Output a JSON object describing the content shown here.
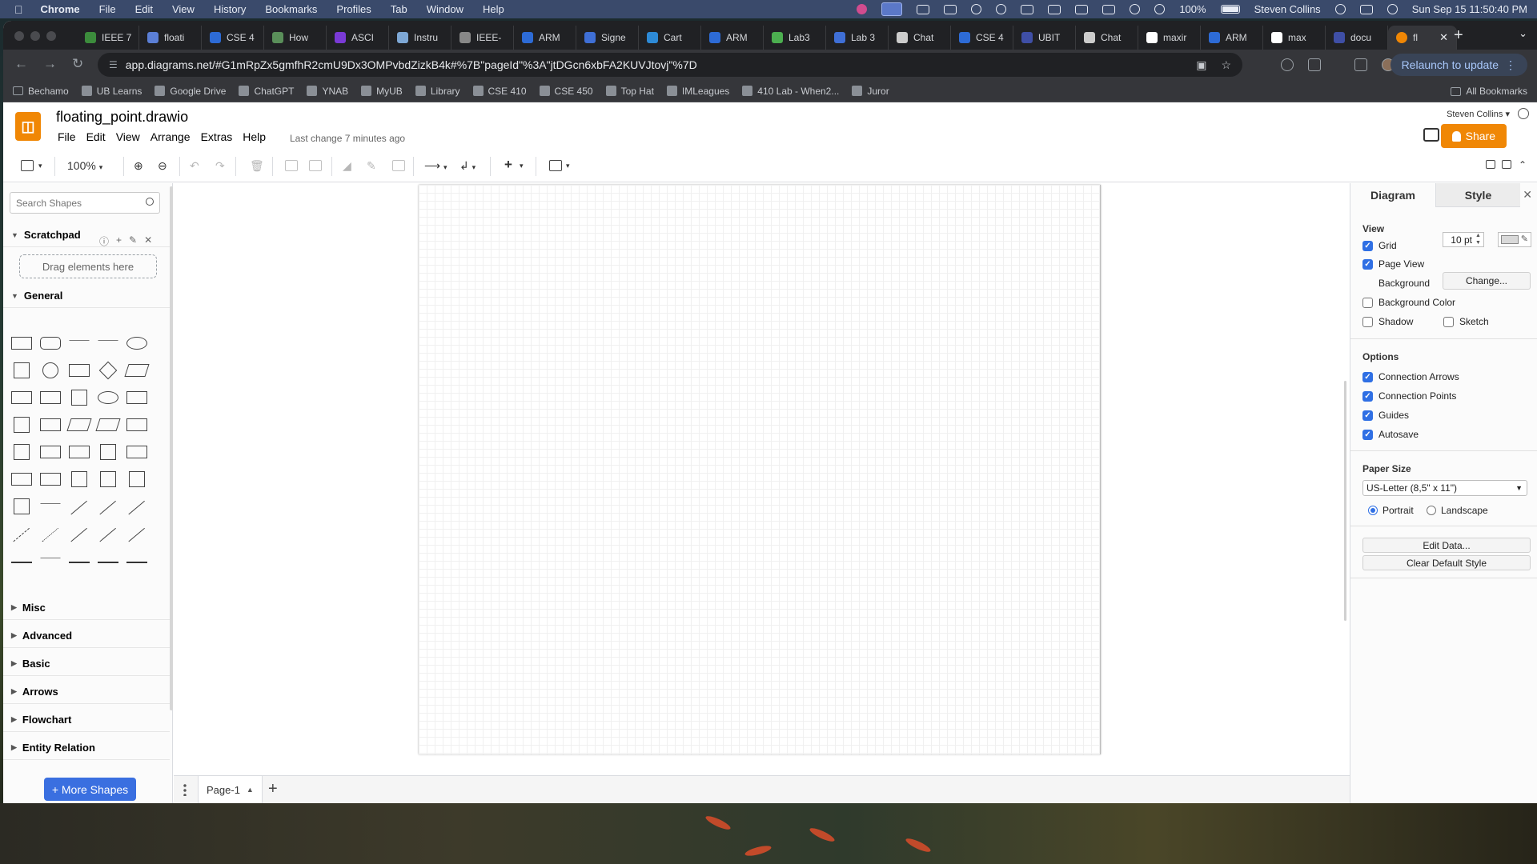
{
  "mac_menubar": {
    "app": "Chrome",
    "menus": [
      "File",
      "Edit",
      "View",
      "History",
      "Bookmarks",
      "Profiles",
      "Tab",
      "Window",
      "Help"
    ],
    "battery": "100%",
    "user": "Steven Collins",
    "datetime": "Sun Sep 15  11:50:40 PM"
  },
  "browser": {
    "tabs": [
      {
        "label": "IEEE 7"
      },
      {
        "label": "floati"
      },
      {
        "label": "CSE 4"
      },
      {
        "label": "How"
      },
      {
        "label": "ASCI"
      },
      {
        "label": "Instru"
      },
      {
        "label": "IEEE-"
      },
      {
        "label": "ARM"
      },
      {
        "label": "Signe"
      },
      {
        "label": "Cart"
      },
      {
        "label": "ARM"
      },
      {
        "label": "Lab3"
      },
      {
        "label": "Lab 3"
      },
      {
        "label": "Chat"
      },
      {
        "label": "CSE 4"
      },
      {
        "label": "UBIT"
      },
      {
        "label": "Chat"
      },
      {
        "label": "maxir"
      },
      {
        "label": "ARM"
      },
      {
        "label": "max"
      },
      {
        "label": "docu"
      }
    ],
    "active_tab": {
      "label": "fl"
    },
    "url": "app.diagrams.net/#G1mRpZx5gmfhR2cmU9Dx3OMPvbdZizkB4k#%7B\"pageId\"%3A\"jtDGcn6xbFA2KUVJtovj\"%7D",
    "relaunch_label": "Relaunch to update",
    "bookmarks": [
      "Bechamo",
      "UB Learns",
      "Google Drive",
      "ChatGPT",
      "YNAB",
      "MyUB",
      "Library",
      "CSE 410",
      "CSE 450",
      "Top Hat",
      "IMLeagues",
      "410 Lab - When2...",
      "Juror"
    ],
    "all_bookmarks": "All Bookmarks"
  },
  "drawio": {
    "filename": "floating_point.drawio",
    "menus": [
      "File",
      "Edit",
      "View",
      "Arrange",
      "Extras",
      "Help"
    ],
    "last_change": "Last change 7 minutes ago",
    "user": "Steven Collins",
    "share_label": "Share",
    "zoom": "100%",
    "sidebar": {
      "search_placeholder": "Search Shapes",
      "scratchpad_title": "Scratchpad",
      "drop_hint": "Drag elements here",
      "general_title": "General",
      "collapsed_sections": [
        "Misc",
        "Advanced",
        "Basic",
        "Arrows",
        "Flowchart",
        "Entity Relation"
      ],
      "more_shapes": "+ More Shapes"
    },
    "page_tab": "Page-1",
    "format_panel": {
      "tabs": [
        "Diagram",
        "Style"
      ],
      "view_heading": "View",
      "grid_label": "Grid",
      "grid_size": "10 pt",
      "page_view_label": "Page View",
      "background_label": "Background",
      "change_button": "Change...",
      "background_color_label": "Background Color",
      "shadow_label": "Shadow",
      "sketch_label": "Sketch",
      "options_heading": "Options",
      "connection_arrows": "Connection Arrows",
      "connection_points": "Connection Points",
      "guides": "Guides",
      "autosave": "Autosave",
      "paper_size_heading": "Paper Size",
      "paper_size": "US-Letter (8,5\" x 11\")",
      "portrait": "Portrait",
      "landscape": "Landscape",
      "edit_data": "Edit Data...",
      "clear_default_style": "Clear Default Style",
      "checks": {
        "grid": true,
        "page_view": true,
        "background_color": false,
        "shadow": false,
        "sketch": false,
        "connection_arrows": true,
        "connection_points": true,
        "guides": true,
        "autosave": true
      }
    }
  },
  "colors": {
    "accent": "#f08705",
    "checkbox": "#2f6fe4",
    "menubar": "#3a4a6b",
    "chrome_dark": "#35363a"
  }
}
